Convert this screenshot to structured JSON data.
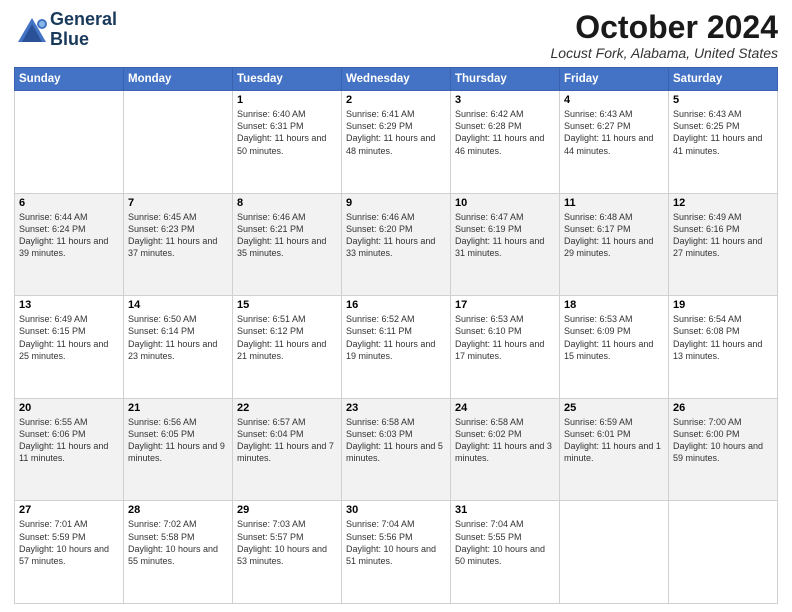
{
  "header": {
    "logo_line1": "General",
    "logo_line2": "Blue",
    "title": "October 2024",
    "location": "Locust Fork, Alabama, United States"
  },
  "days_of_week": [
    "Sunday",
    "Monday",
    "Tuesday",
    "Wednesday",
    "Thursday",
    "Friday",
    "Saturday"
  ],
  "weeks": [
    [
      {
        "day": "",
        "text": ""
      },
      {
        "day": "",
        "text": ""
      },
      {
        "day": "1",
        "text": "Sunrise: 6:40 AM\nSunset: 6:31 PM\nDaylight: 11 hours and 50 minutes."
      },
      {
        "day": "2",
        "text": "Sunrise: 6:41 AM\nSunset: 6:29 PM\nDaylight: 11 hours and 48 minutes."
      },
      {
        "day": "3",
        "text": "Sunrise: 6:42 AM\nSunset: 6:28 PM\nDaylight: 11 hours and 46 minutes."
      },
      {
        "day": "4",
        "text": "Sunrise: 6:43 AM\nSunset: 6:27 PM\nDaylight: 11 hours and 44 minutes."
      },
      {
        "day": "5",
        "text": "Sunrise: 6:43 AM\nSunset: 6:25 PM\nDaylight: 11 hours and 41 minutes."
      }
    ],
    [
      {
        "day": "6",
        "text": "Sunrise: 6:44 AM\nSunset: 6:24 PM\nDaylight: 11 hours and 39 minutes."
      },
      {
        "day": "7",
        "text": "Sunrise: 6:45 AM\nSunset: 6:23 PM\nDaylight: 11 hours and 37 minutes."
      },
      {
        "day": "8",
        "text": "Sunrise: 6:46 AM\nSunset: 6:21 PM\nDaylight: 11 hours and 35 minutes."
      },
      {
        "day": "9",
        "text": "Sunrise: 6:46 AM\nSunset: 6:20 PM\nDaylight: 11 hours and 33 minutes."
      },
      {
        "day": "10",
        "text": "Sunrise: 6:47 AM\nSunset: 6:19 PM\nDaylight: 11 hours and 31 minutes."
      },
      {
        "day": "11",
        "text": "Sunrise: 6:48 AM\nSunset: 6:17 PM\nDaylight: 11 hours and 29 minutes."
      },
      {
        "day": "12",
        "text": "Sunrise: 6:49 AM\nSunset: 6:16 PM\nDaylight: 11 hours and 27 minutes."
      }
    ],
    [
      {
        "day": "13",
        "text": "Sunrise: 6:49 AM\nSunset: 6:15 PM\nDaylight: 11 hours and 25 minutes."
      },
      {
        "day": "14",
        "text": "Sunrise: 6:50 AM\nSunset: 6:14 PM\nDaylight: 11 hours and 23 minutes."
      },
      {
        "day": "15",
        "text": "Sunrise: 6:51 AM\nSunset: 6:12 PM\nDaylight: 11 hours and 21 minutes."
      },
      {
        "day": "16",
        "text": "Sunrise: 6:52 AM\nSunset: 6:11 PM\nDaylight: 11 hours and 19 minutes."
      },
      {
        "day": "17",
        "text": "Sunrise: 6:53 AM\nSunset: 6:10 PM\nDaylight: 11 hours and 17 minutes."
      },
      {
        "day": "18",
        "text": "Sunrise: 6:53 AM\nSunset: 6:09 PM\nDaylight: 11 hours and 15 minutes."
      },
      {
        "day": "19",
        "text": "Sunrise: 6:54 AM\nSunset: 6:08 PM\nDaylight: 11 hours and 13 minutes."
      }
    ],
    [
      {
        "day": "20",
        "text": "Sunrise: 6:55 AM\nSunset: 6:06 PM\nDaylight: 11 hours and 11 minutes."
      },
      {
        "day": "21",
        "text": "Sunrise: 6:56 AM\nSunset: 6:05 PM\nDaylight: 11 hours and 9 minutes."
      },
      {
        "day": "22",
        "text": "Sunrise: 6:57 AM\nSunset: 6:04 PM\nDaylight: 11 hours and 7 minutes."
      },
      {
        "day": "23",
        "text": "Sunrise: 6:58 AM\nSunset: 6:03 PM\nDaylight: 11 hours and 5 minutes."
      },
      {
        "day": "24",
        "text": "Sunrise: 6:58 AM\nSunset: 6:02 PM\nDaylight: 11 hours and 3 minutes."
      },
      {
        "day": "25",
        "text": "Sunrise: 6:59 AM\nSunset: 6:01 PM\nDaylight: 11 hours and 1 minute."
      },
      {
        "day": "26",
        "text": "Sunrise: 7:00 AM\nSunset: 6:00 PM\nDaylight: 10 hours and 59 minutes."
      }
    ],
    [
      {
        "day": "27",
        "text": "Sunrise: 7:01 AM\nSunset: 5:59 PM\nDaylight: 10 hours and 57 minutes."
      },
      {
        "day": "28",
        "text": "Sunrise: 7:02 AM\nSunset: 5:58 PM\nDaylight: 10 hours and 55 minutes."
      },
      {
        "day": "29",
        "text": "Sunrise: 7:03 AM\nSunset: 5:57 PM\nDaylight: 10 hours and 53 minutes."
      },
      {
        "day": "30",
        "text": "Sunrise: 7:04 AM\nSunset: 5:56 PM\nDaylight: 10 hours and 51 minutes."
      },
      {
        "day": "31",
        "text": "Sunrise: 7:04 AM\nSunset: 5:55 PM\nDaylight: 10 hours and 50 minutes."
      },
      {
        "day": "",
        "text": ""
      },
      {
        "day": "",
        "text": ""
      }
    ]
  ]
}
